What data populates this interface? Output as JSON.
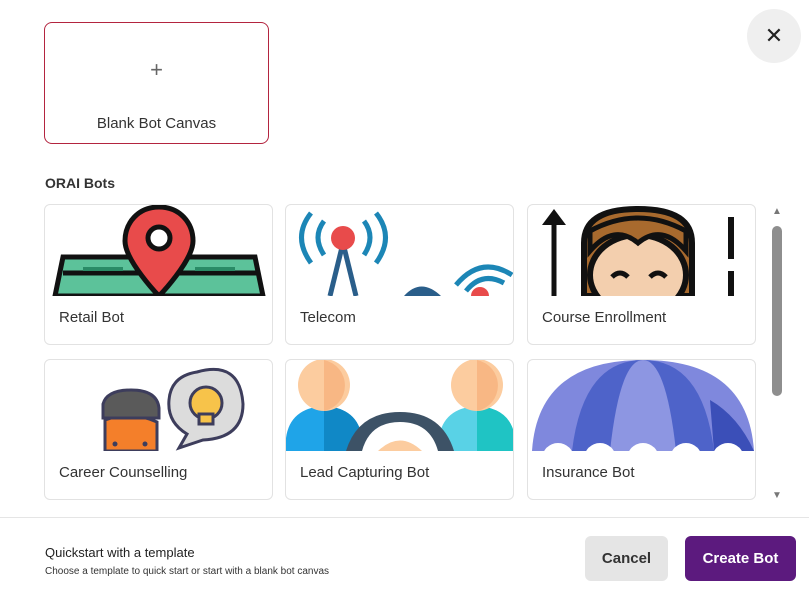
{
  "close": {
    "icon": "close-icon",
    "glyph": "✕"
  },
  "blank_canvas": {
    "icon": "plus-icon",
    "glyph": "+",
    "label": "Blank Bot Canvas"
  },
  "section_title": "ORAI Bots",
  "templates": [
    {
      "label": "Retail Bot",
      "icon": "map-pin-icon"
    },
    {
      "label": "Telecom",
      "icon": "signal-tower-icon"
    },
    {
      "label": "Course Enrollment",
      "icon": "student-icon"
    },
    {
      "label": "Career Counselling",
      "icon": "idea-person-icon"
    },
    {
      "label": "Lead Capturing Bot",
      "icon": "people-magnifier-icon"
    },
    {
      "label": "Insurance Bot",
      "icon": "umbrella-icon"
    }
  ],
  "scroll": {
    "up_glyph": "▲",
    "down_glyph": "▼"
  },
  "footer": {
    "title": "Quickstart with a template",
    "subtitle": "Choose a template to quick start or start with a blank bot canvas",
    "cancel_label": "Cancel",
    "create_label": "Create Bot"
  },
  "colors": {
    "accent": "#5c1a7e",
    "selected_border": "#b3243f"
  }
}
